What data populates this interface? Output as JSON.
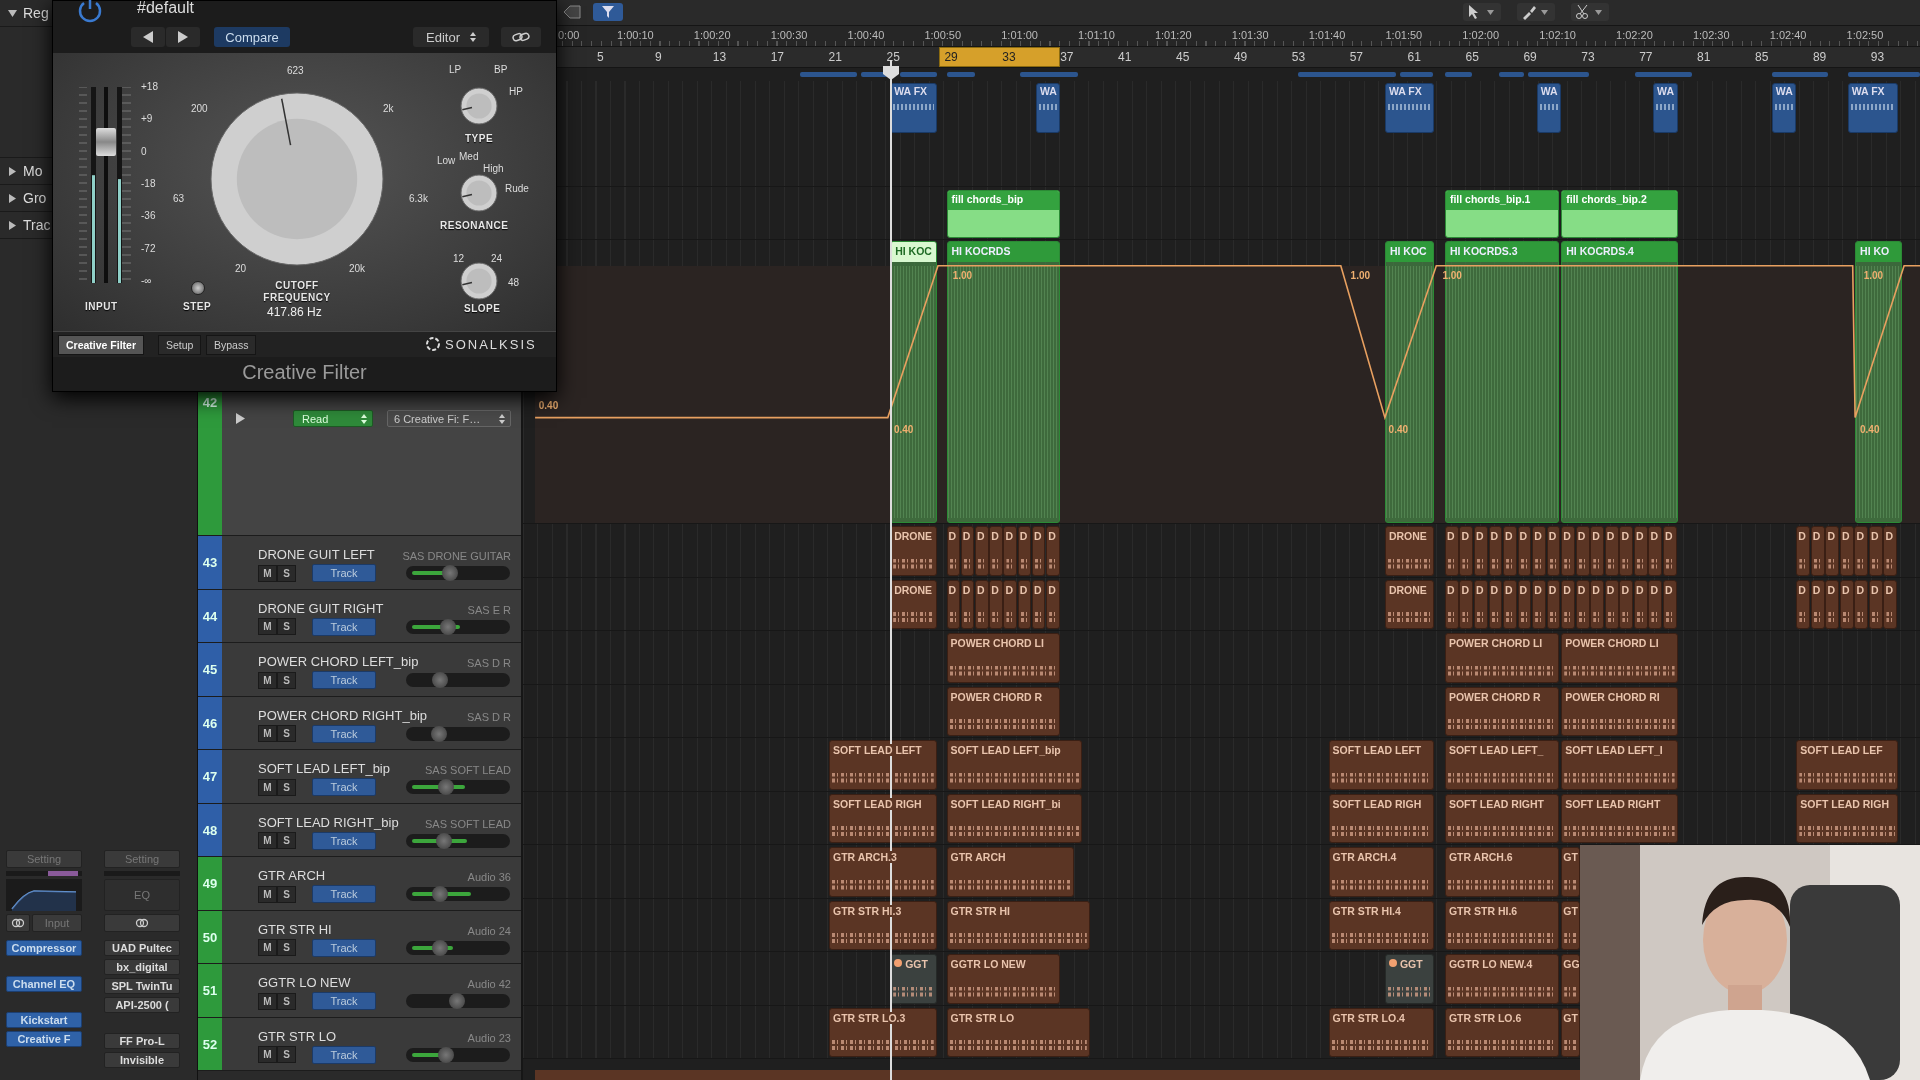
{
  "sidebar": {
    "sections": [
      {
        "label": "Reg",
        "expanded": true
      },
      {
        "label": "Mo",
        "expanded": false
      },
      {
        "label": "Gro",
        "expanded": false
      },
      {
        "label": "Trac",
        "expanded": false
      }
    ]
  },
  "channel_strips": [
    {
      "setting": "Setting",
      "input": "Input",
      "plugins": [
        "Compressor",
        "Channel EQ",
        "Kickstart",
        "Creative F"
      ]
    },
    {
      "setting": "Setting",
      "eq": "EQ",
      "plugins": [
        "UAD Pultec",
        "bx_digital",
        "SPL TwinTu",
        "API-2500 (",
        "FF Pro-L",
        "Invisible"
      ]
    }
  ],
  "ruler": {
    "times": [
      "0:00",
      "1:00:10",
      "1:00:20",
      "1:00:30",
      "1:00:40",
      "1:00:50",
      "1:01:00",
      "1:01:10",
      "1:01:20",
      "1:01:30",
      "1:01:40",
      "1:01:50",
      "1:02:00",
      "1:02:10",
      "1:02:20",
      "1:02:30",
      "1:02:40",
      "1:02:50"
    ],
    "bars": [
      "5",
      "9",
      "13",
      "17",
      "21",
      "25",
      "29",
      "33",
      "37",
      "41",
      "45",
      "49",
      "53",
      "57",
      "61",
      "65",
      "69",
      "73",
      "77",
      "81",
      "85",
      "89",
      "93"
    ]
  },
  "upper_lanes": [
    {
      "regions": [
        {
          "name": "WA FX"
        },
        {
          "name": "WA"
        },
        {
          "name": "WA FX"
        },
        {
          "name": "WA"
        },
        {
          "name": "WA"
        },
        {
          "name": "WA"
        },
        {
          "name": "WA FX"
        }
      ]
    },
    {
      "regions": [
        {
          "name": "fill chords_bip"
        },
        {
          "name": "fill chords_bip.1"
        },
        {
          "name": "fill chords_bip.2"
        }
      ]
    }
  ],
  "automation_track": {
    "number": "42",
    "color": "#2e9a3c",
    "mode": "Read",
    "parameter": "6 Creative Fi: F…",
    "regions": [
      {
        "name": "HI KOC",
        "selected": true
      },
      {
        "name": "HI KOCRDS",
        "selected": false
      },
      {
        "name": "HI KOC",
        "selected": false
      },
      {
        "name": "HI KOCRDS.3",
        "selected": false
      },
      {
        "name": "HI KOCRDS.4",
        "selected": false
      },
      {
        "name": "HI KO",
        "selected": false
      }
    ],
    "values": [
      "0.40",
      "0.40",
      "1.00",
      "1.00",
      "0.40",
      "1.00",
      "0.40",
      "1.00"
    ]
  },
  "tracks": [
    {
      "number": "43",
      "name": "DRONE GUIT LEFT",
      "detail": "SAS DRONE GUITAR",
      "mute": "M",
      "solo": "S",
      "mode": "Track",
      "color": "#2f5fa8",
      "fader": {
        "level": 0.42
      },
      "meter": {
        "level": 0.36
      },
      "regions": [
        "DRONE",
        "D",
        "D",
        "D",
        "D",
        "D",
        "D",
        "D",
        "D",
        "DRONE",
        "D",
        "D",
        "D",
        "D",
        "D",
        "D",
        "D",
        "D",
        "D",
        "D",
        "D",
        "D",
        "D",
        "D",
        "D",
        "D",
        "D",
        "D",
        "D",
        "D",
        "D",
        "D",
        "D"
      ]
    },
    {
      "number": "44",
      "name": "DRONE GUIT RIGHT",
      "detail": "SAS E R",
      "mute": "M",
      "solo": "S",
      "mode": "Track",
      "color": "#2f5fa8",
      "fader": {
        "level": 0.4
      },
      "meter": {
        "level": 0.52
      },
      "regions": [
        "DRONE",
        "D",
        "D",
        "D",
        "D",
        "D",
        "D",
        "D",
        "D",
        "DRONE",
        "D",
        "D",
        "D",
        "D",
        "D",
        "D",
        "D",
        "D",
        "D",
        "D",
        "D",
        "D",
        "D",
        "D",
        "D",
        "D",
        "D",
        "D",
        "D",
        "D",
        "D",
        "D",
        "D"
      ]
    },
    {
      "number": "45",
      "name": "POWER CHORD LEFT_bip",
      "detail": "SAS D R",
      "mute": "M",
      "solo": "S",
      "mode": "Track",
      "color": "#2f5fa8",
      "fader": {
        "level": 0.33
      },
      "regions": [
        "POWER CHORD LI",
        "POWER CHORD LI",
        "POWER CHORD LI"
      ]
    },
    {
      "number": "46",
      "name": "POWER CHORD RIGHT_bip",
      "detail": "SAS D R",
      "mute": "M",
      "solo": "S",
      "mode": "Track",
      "color": "#2f5fa8",
      "fader": {
        "level": 0.32
      },
      "regions": [
        "POWER CHORD R",
        "POWER CHORD R",
        "POWER CHORD RI"
      ]
    },
    {
      "number": "47",
      "name": "SOFT LEAD LEFT_bip",
      "detail": "SAS SOFT LEAD",
      "mute": "M",
      "solo": "S",
      "mode": "Track",
      "color": "#2f5fa8",
      "fader": {
        "level": 0.38
      },
      "meter": {
        "level": 0.58
      },
      "regions": [
        "SOFT LEAD LEFT",
        "SOFT LEAD LEFT_bip",
        "SOFT LEAD LEFT",
        "SOFT LEAD LEFT_",
        "SOFT LEAD LEFT_I",
        "SOFT LEAD LEF"
      ]
    },
    {
      "number": "48",
      "name": "SOFT LEAD RIGHT_bip",
      "detail": "SAS SOFT LEAD",
      "mute": "M",
      "solo": "S",
      "mode": "Track",
      "color": "#2f5fa8",
      "fader": {
        "level": 0.37
      },
      "meter": {
        "level": 0.6
      },
      "regions": [
        "SOFT LEAD RIGH",
        "SOFT LEAD RIGHT_bi",
        "SOFT LEAD RIGH",
        "SOFT LEAD RIGHT",
        "SOFT LEAD RIGHT",
        "SOFT LEAD RIGH"
      ]
    },
    {
      "number": "49",
      "name": "GTR ARCH",
      "detail": "Audio 36",
      "mute": "M",
      "solo": "S",
      "mode": "Track",
      "color": "#2e9a3c",
      "fader": {
        "level": 0.33
      },
      "meter": {
        "level": 0.64
      },
      "regions": [
        "GTR ARCH.3",
        "GTR ARCH",
        "GTR ARCH.4",
        "GTR ARCH.6",
        "GT"
      ]
    },
    {
      "number": "50",
      "name": "GTR STR HI",
      "detail": "Audio 24",
      "mute": "M",
      "solo": "S",
      "mode": "Track",
      "color": "#2e9a3c",
      "fader": {
        "level": 0.33
      },
      "meter": {
        "level": 0.45
      },
      "regions": [
        "GTR STR HI.3",
        "GTR STR HI",
        "GTR STR HI.4",
        "GTR STR HI.6",
        "GT"
      ]
    },
    {
      "number": "51",
      "name": "GGTR LO NEW",
      "detail": "Audio 42",
      "mute": "M",
      "solo": "S",
      "mode": "Track",
      "color": "#2e9a3c",
      "fader": {
        "level": 0.49
      },
      "regions": [
        "GGT",
        "GGTR LO NEW",
        "GGT",
        "GGTR LO NEW.4",
        "GG"
      ]
    },
    {
      "number": "52",
      "name": "GTR STR LO",
      "detail": "Audio 23",
      "mute": "M",
      "solo": "S",
      "mode": "Track",
      "color": "#2e9a3c",
      "fader": {
        "level": 0.38
      },
      "meter": {
        "level": 0.4
      },
      "regions": [
        "GTR STR LO.3",
        "GTR STR LO",
        "GTR STR LO.4",
        "GTR STR LO.6",
        "GT"
      ]
    }
  ],
  "plugin": {
    "preset": "#default",
    "compare": "Compare",
    "editor": "Editor",
    "input": {
      "label": "INPUT",
      "fader": {
        "level": 0.72
      },
      "meters": [
        {
          "level": 0.55
        },
        {
          "level": 0.53
        }
      ],
      "scale": [
        "+18",
        "+9",
        "0",
        "-18",
        "-36",
        "-72",
        "-∞"
      ]
    },
    "step": {
      "label": "STEP"
    },
    "cutoff": {
      "label": "CUTOFF FREQUENCY",
      "value": "417.86 Hz",
      "level": 0.46,
      "scale": [
        "20",
        "63",
        "200",
        "623",
        "2k",
        "6.3k",
        "20k"
      ]
    },
    "type": {
      "label": "TYPE",
      "scale": [
        "LP",
        "BP",
        "HP"
      ]
    },
    "resonance": {
      "label": "RESONANCE",
      "scale": [
        "Low",
        "Med",
        "High",
        "Rude"
      ]
    },
    "slope": {
      "label": "SLOPE",
      "scale": [
        "12",
        "24",
        "48"
      ]
    },
    "tabs": [
      {
        "label": "Creative Filter",
        "selected": true
      },
      {
        "label": "Setup",
        "selected": false
      },
      {
        "label": "Bypass",
        "selected": false
      }
    ],
    "brand": "SONALKSIS",
    "title": "Creative Filter"
  }
}
